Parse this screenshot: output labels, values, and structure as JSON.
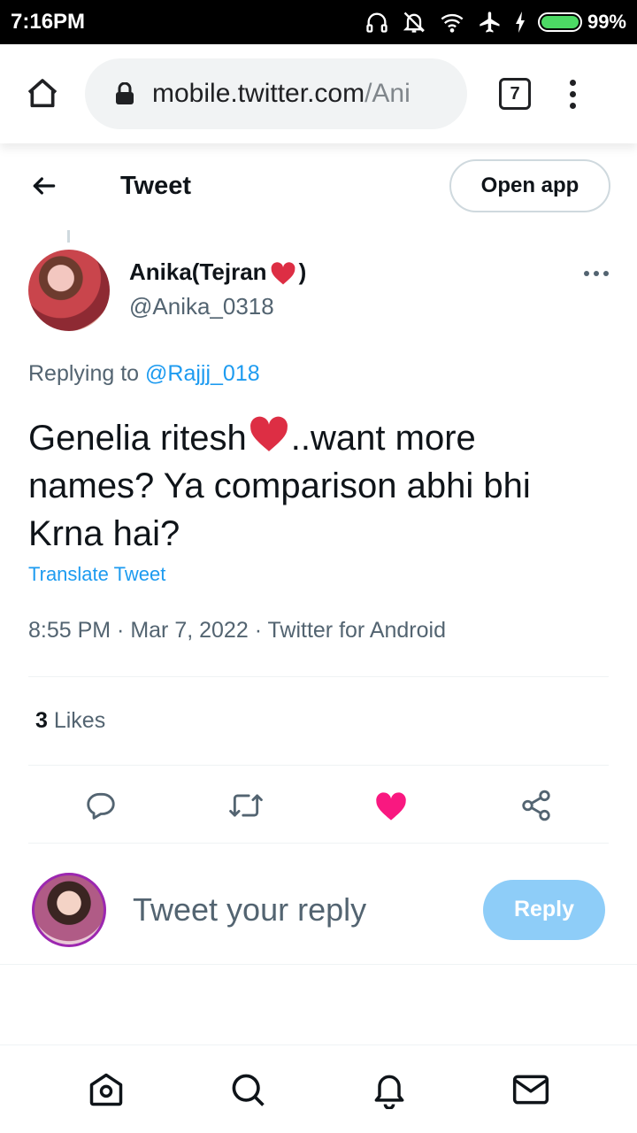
{
  "status_bar": {
    "time": "7:16PM",
    "battery": "99%",
    "battery_level": 0.99
  },
  "browser": {
    "url_host": "mobile.twitter.com",
    "url_path": "/Ani",
    "tab_count": "7"
  },
  "header": {
    "title": "Tweet",
    "open_app_label": "Open app"
  },
  "tweet": {
    "author_name": "Anika(Tejran",
    "author_name_close": ")",
    "author_handle": "@Anika_0318",
    "replying_prefix": "Replying to ",
    "replying_to": "@Rajjj_018",
    "text_before_heart": "Genelia ritesh",
    "text_after_heart": "..want more names? Ya comparison abhi bhi Krna hai?",
    "translate_label": "Translate Tweet",
    "time": "8:55 PM",
    "date": "Mar 7, 2022",
    "source": "Twitter for Android",
    "separator": " · ",
    "likes_count": "3",
    "likes_label": " Likes"
  },
  "reply": {
    "placeholder": "Tweet your reply",
    "button_label": "Reply"
  },
  "colors": {
    "accent": "#1d9bf0",
    "like": "#f91880",
    "heart": "#dd2e44",
    "reply_button": "#8ecdf8"
  },
  "icons": {
    "status": [
      "headphones-icon",
      "bell-off-icon",
      "wifi-icon",
      "airplane-icon",
      "charging-icon",
      "battery-icon"
    ],
    "actions": [
      "reply-icon",
      "retweet-icon",
      "like-icon",
      "share-icon"
    ],
    "nav": [
      "home-icon",
      "search-icon",
      "notifications-icon",
      "messages-icon"
    ]
  }
}
